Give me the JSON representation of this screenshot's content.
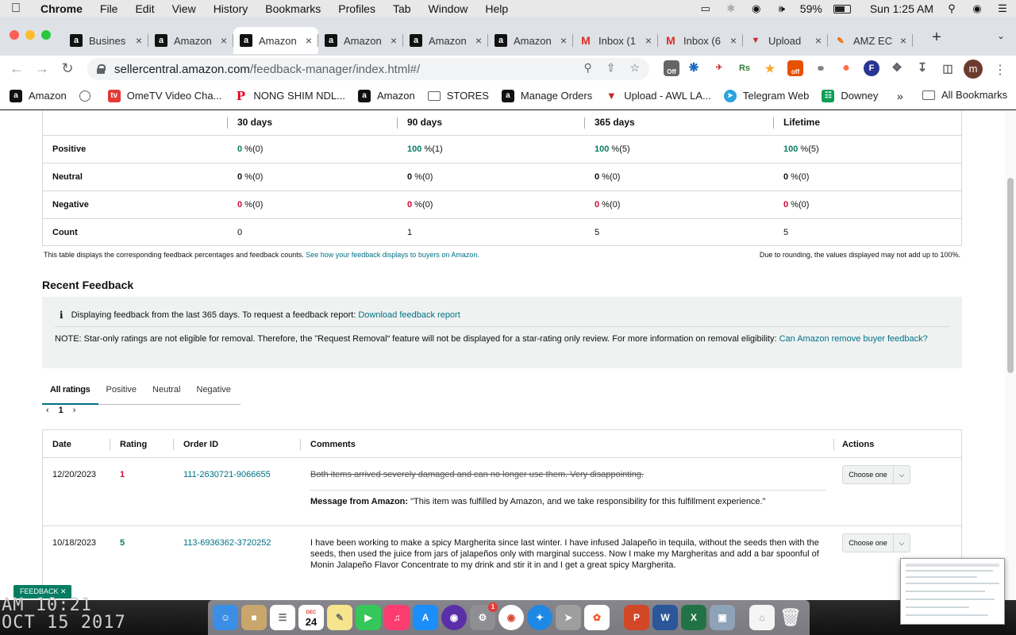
{
  "menubar": {
    "app": "Chrome",
    "items": [
      "File",
      "Edit",
      "View",
      "History",
      "Bookmarks",
      "Profiles",
      "Tab",
      "Window",
      "Help"
    ],
    "battery": "59%",
    "clock": "Sun 1:25 AM"
  },
  "tabs": [
    {
      "title": "Busines",
      "favicon": "a"
    },
    {
      "title": "Amazon",
      "favicon": "a"
    },
    {
      "title": "Amazon",
      "favicon": "a",
      "active": true
    },
    {
      "title": "Amazon",
      "favicon": "a"
    },
    {
      "title": "Amazon",
      "favicon": "a"
    },
    {
      "title": "Amazon",
      "favicon": "a"
    },
    {
      "title": "Inbox (1",
      "favicon": "M"
    },
    {
      "title": "Inbox (6",
      "favicon": "M"
    },
    {
      "title": "Upload",
      "favicon": "▼"
    },
    {
      "title": "AMZ EC",
      "favicon": "✎"
    }
  ],
  "address": {
    "host": "sellercentral.amazon.com",
    "path": "/feedback-manager/index.html#/"
  },
  "extensions": {
    "off_badge": "Off",
    "off_badge2": "off"
  },
  "profile_initial": "m",
  "bookmarks": [
    {
      "label": "Amazon",
      "icon": "a"
    },
    {
      "label": "",
      "icon": "globe"
    },
    {
      "label": "OmeTV Video Cha...",
      "icon": "tv"
    },
    {
      "label": "NONG SHIM NDL...",
      "icon": "pinterest"
    },
    {
      "label": "Amazon",
      "icon": "a"
    },
    {
      "label": "STORES",
      "icon": "folder"
    },
    {
      "label": "Manage Orders",
      "icon": "a"
    },
    {
      "label": "Upload - AWL LA...",
      "icon": "▼"
    },
    {
      "label": "Telegram Web",
      "icon": "telegram"
    },
    {
      "label": "Downey",
      "icon": "sheets"
    }
  ],
  "bookmarks_all": "All Bookmarks",
  "summary": {
    "columns": [
      "30 days",
      "90 days",
      "365 days",
      "Lifetime"
    ],
    "rows": [
      {
        "label": "Positive",
        "cells": [
          [
            "0",
            " %(0)"
          ],
          [
            "100",
            " %(1)"
          ],
          [
            "100",
            " %(5)"
          ],
          [
            "100",
            " %(5)"
          ]
        ],
        "tone": "green"
      },
      {
        "label": "Neutral",
        "cells": [
          [
            "0",
            " %(0)"
          ],
          [
            "0",
            " %(0)"
          ],
          [
            "0",
            " %(0)"
          ],
          [
            "0",
            " %(0)"
          ]
        ],
        "tone": "neutral"
      },
      {
        "label": "Negative",
        "cells": [
          [
            "0",
            " %(0)"
          ],
          [
            "0",
            " %(0)"
          ],
          [
            "0",
            " %(0)"
          ],
          [
            "0",
            " %(0)"
          ]
        ],
        "tone": "red"
      },
      {
        "label": "Count",
        "cells": [
          [
            "",
            "0"
          ],
          [
            "",
            "1"
          ],
          [
            "",
            "5"
          ],
          [
            "",
            "5"
          ]
        ],
        "tone": "plain"
      }
    ],
    "disclaimer": "This table displays the corresponding feedback percentages and feedback counts.",
    "disclaimer_link": "See how your feedback displays to buyers on Amazon.",
    "rounding_note": "Due to rounding, the values displayed may not add up to 100%."
  },
  "recent": {
    "title": "Recent Feedback",
    "info_text": "Displaying feedback from the last 365 days. To request a feedback report:",
    "info_link": "Download feedback report",
    "note_text": "NOTE: Star-only ratings are not eligible for removal. Therefore, the ”Request Removal“ feature will not be displayed for a star-rating only review. For more information on removal eligibility:",
    "note_link": "Can Amazon remove buyer feedback?",
    "tabs": [
      "All ratings",
      "Positive",
      "Neutral",
      "Negative"
    ],
    "page": "1"
  },
  "feedback_table": {
    "headers": [
      "Date",
      "Rating",
      "Order ID",
      "Comments",
      "Actions"
    ],
    "rows": [
      {
        "date": "12/20/2023",
        "rating": "1",
        "order_id": "111-2630721-9066655",
        "comment": "Both items arrived severely damaged and can no longer use them. Very disappointing.",
        "message_label": "Message from Amazon:",
        "message": " \"This item was fulfilled by Amazon, and we take responsibility for this fulfillment experience.\"",
        "action": "Choose one"
      },
      {
        "date": "10/18/2023",
        "rating": "5",
        "order_id": "113-6936362-3720252",
        "comment": "I have been working to make a spicy Margherita since last winter. I have infused Jalapeño in tequila, without the seeds then with the seeds, then used the juice from jars of jalapeños only with marginal success. Now I make my Margheritas and add a bar spoonful of Monin Jalapeño Flavor Concentrate to my drink and stir it in and I get a great spicy Margherita.",
        "action": "Choose one"
      }
    ]
  },
  "feedback_badge": "FEEDBACK ✕",
  "desktop": {
    "date_line1": "AM 10:21",
    "date_line2": "OCT 15 2017"
  },
  "dock": {
    "calendar_month": "DEC",
    "calendar_day": "24",
    "prefs_badge": "1"
  },
  "colors": {
    "accent_link": "#007185",
    "positive": "#067d62",
    "negative": "#cc0c39"
  }
}
